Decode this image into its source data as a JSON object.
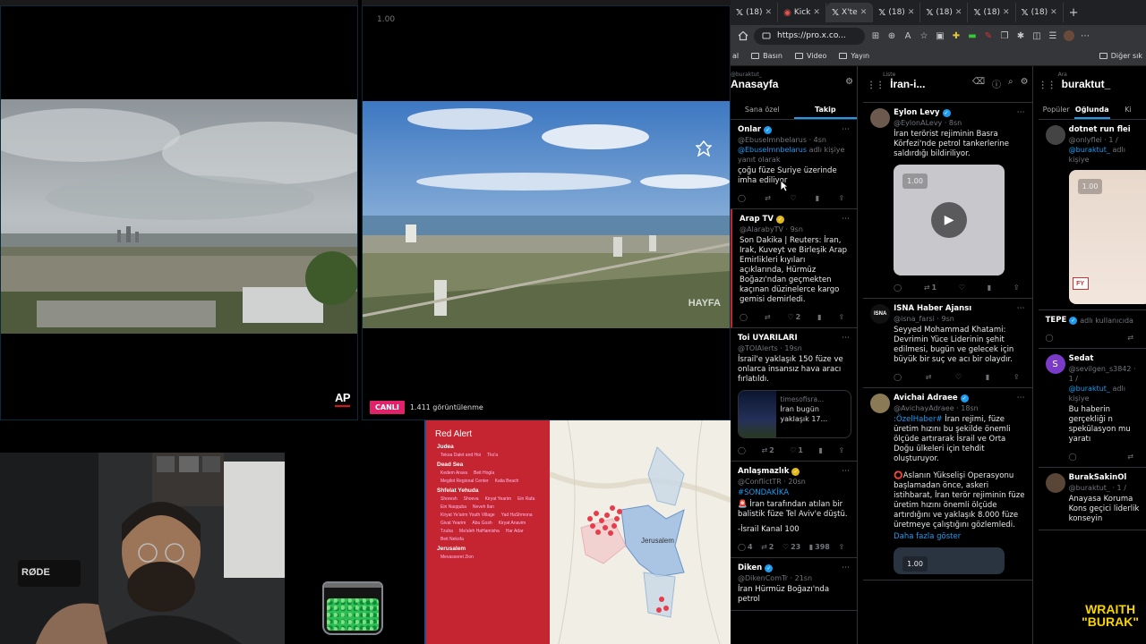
{
  "video_left": {
    "source_logo": "AP"
  },
  "video_right": {
    "speed_overlay": "1.00",
    "watermark": "HAYFA",
    "live_label": "CANLI",
    "view_count": "1.411 görüntülenme"
  },
  "webcam": {
    "mic_brand": "RØDE"
  },
  "red_alert": {
    "title": "Red Alert",
    "regions": [
      {
        "name": "Judea",
        "places": [
          "Tekoa Dalet and Hoi",
          "Tko'a"
        ]
      },
      {
        "name": "Dead Sea",
        "places": [
          "Kedem Arava",
          "Beit Hogla",
          "Megilot Regional Center",
          "Kalia Beach"
        ]
      },
      {
        "name": "Shfelat Yehuda",
        "places": [
          "Shoresh",
          "Shoeva",
          "Kiryat Yearim",
          "Ein Rafa",
          "Ein Naqquba",
          "Neveh Ilan",
          "Kiryat Ye'arim Youth Village",
          "Yad HaShmona",
          "Givat Yearim",
          "Abu Gosh",
          "Kiryat Anavim",
          "Tzuba",
          "Ma'aleh HaHamisha",
          "Har Adar",
          "Beit Nekofa"
        ]
      },
      {
        "name": "Jerusalem",
        "places": [
          "Mevasseret Zion"
        ]
      }
    ],
    "map_label": "Jerusalem"
  },
  "browser": {
    "tabs": [
      {
        "label": "(18)",
        "icon": "x",
        "active": false
      },
      {
        "label": "Kick",
        "icon": "kick",
        "active": false
      },
      {
        "label": "X'te",
        "icon": "x",
        "active": true
      },
      {
        "label": "(18)",
        "icon": "x",
        "active": false
      },
      {
        "label": "(18)",
        "icon": "x",
        "active": false
      },
      {
        "label": "(18)",
        "icon": "x",
        "active": false
      },
      {
        "label": "(18)",
        "icon": "x",
        "active": false
      }
    ],
    "url": "https://pro.x.co...",
    "bookmarks": [
      "Basın",
      "Video",
      "Yayın"
    ],
    "other_bookmarks": "Diğer sık"
  },
  "deck": {
    "col1": {
      "subtitle": "@buraktut_",
      "title": "Anasayfa",
      "tabs": [
        "Sana özel",
        "Takip"
      ],
      "tweets": [
        {
          "name": "Onlar",
          "verified": "blue",
          "handle": "@Ebuselmnbelarus · 4sn",
          "reply_to": "@Ebuselmnbelarus",
          "reply_suffix": "adlı kişiye yanıt olarak",
          "body": "çoğu füze Suriye üzerinde imha ediliyor"
        },
        {
          "name": "Arap TV",
          "verified": "gold",
          "handle": "@AlarabyTV · 9sn",
          "body": "Son Dakika | Reuters: İran, Irak, Kuveyt ve Birleşik Arap Emirlikleri kıyıları açıklarında, Hürmüz Boğazı'ndan geçmekten kaçınan düzinelerce kargo gemisi demirledi.",
          "likes": "2"
        },
        {
          "name": "Toi UYARILARI",
          "verified": "none",
          "handle": "@TOIAlerts · 19sn",
          "body": "İsrail'e yaklaşık 150 füze ve onlarca insansız hava aracı fırlatıldı.",
          "card_domain": "timesofisra...",
          "card_title": "İran bugün yaklaşık 17...",
          "retweets": "2",
          "likes": "1"
        },
        {
          "name": "Anlaşmazlık",
          "verified": "gold",
          "handle": "@ConflictTR · 20sn",
          "hashtag": "#SONDAKİKA",
          "flag": "🚨",
          "body": "İran tarafından atılan bir balistik füze Tel Aviv'e düştü.",
          "source": "-İsrail Kanal 100",
          "replies": "4",
          "retweets": "2",
          "likes": "23",
          "views": "398"
        },
        {
          "name": "Diken",
          "verified": "blue",
          "handle": "@DikenComTr · 21sn",
          "body": "İran Hürmüz Boğazı'nda petrol"
        }
      ]
    },
    "col2": {
      "subtitle": "Liste",
      "title": "İran-i...",
      "tweets": [
        {
          "name": "Eylon Levy",
          "verified": "blue",
          "handle": "@EylonALevy · 8sn",
          "body": "İran terörist rejiminin Basra Körfezi'nde petrol tankerlerine saldırdığı bildiriliyor.",
          "video_speed": "1.00",
          "retweets": "1"
        },
        {
          "name": "ISNA Haber Ajansı",
          "verified": "none",
          "handle": "@isna_farsi · 9sn",
          "body": "Seyyed Mohammad Khatami: Devrimin Yüce Liderinin şehit edilmesi, bugün ve gelecek için büyük bir suç ve acı bir olaydır."
        },
        {
          "name": "Avichai Adraee",
          "verified": "blue",
          "handle": "@AvichayAdraee · 18sn",
          "lead": ":ÖzelHaber#",
          "body": "İran rejimi, füze üretim hızını bu şekilde önemli ölçüde artırarak İsrail ve Orta Doğu ülkeleri için tehdit oluşturuyor.",
          "flag": "⭕",
          "body2": "Aslanın Yükselişi Operasyonu başlamadan önce, askeri istihbarat, İran terör rejiminin füze üretim hızını önemli ölçüde artırdığını ve yaklaşık 8.000 füze üretmeye çalıştığını gözlemledi.",
          "more": "Daha fazla göster",
          "video_speed": "1.00"
        }
      ]
    },
    "col3": {
      "subtitle": "Ara",
      "title": "buraktut_",
      "tabs": [
        "Popüler",
        "Oğlunda",
        "Ki"
      ],
      "tweets": [
        {
          "name": "dotnet run flei",
          "verified": "none",
          "handle": "@onlyflei · 1 /",
          "reply_to": "@buraktut_",
          "reply_suffix": "adlı kişiye",
          "video_speed": "1.00"
        },
        {
          "name": "TEPE",
          "verified": "blue",
          "handle": "adlı kullanıcıda"
        },
        {
          "name": "Sedat",
          "verified": "none",
          "handle": "@sevilgen_s3842 · 1 /",
          "reply_to": "@buraktut_",
          "reply_suffix": "adlı kişiye",
          "body": "Bu haberin gerçekliği n spekülasyon mu yaratı"
        },
        {
          "name": "BurakSakinOl",
          "verified": "none",
          "handle": "@buraktut_ · 1 /",
          "body": "Anayasa Koruma Kons geçici liderlik konseyin"
        }
      ],
      "overlay": {
        "line1": "WRAITH",
        "line2": "\"BURAK\""
      }
    }
  }
}
